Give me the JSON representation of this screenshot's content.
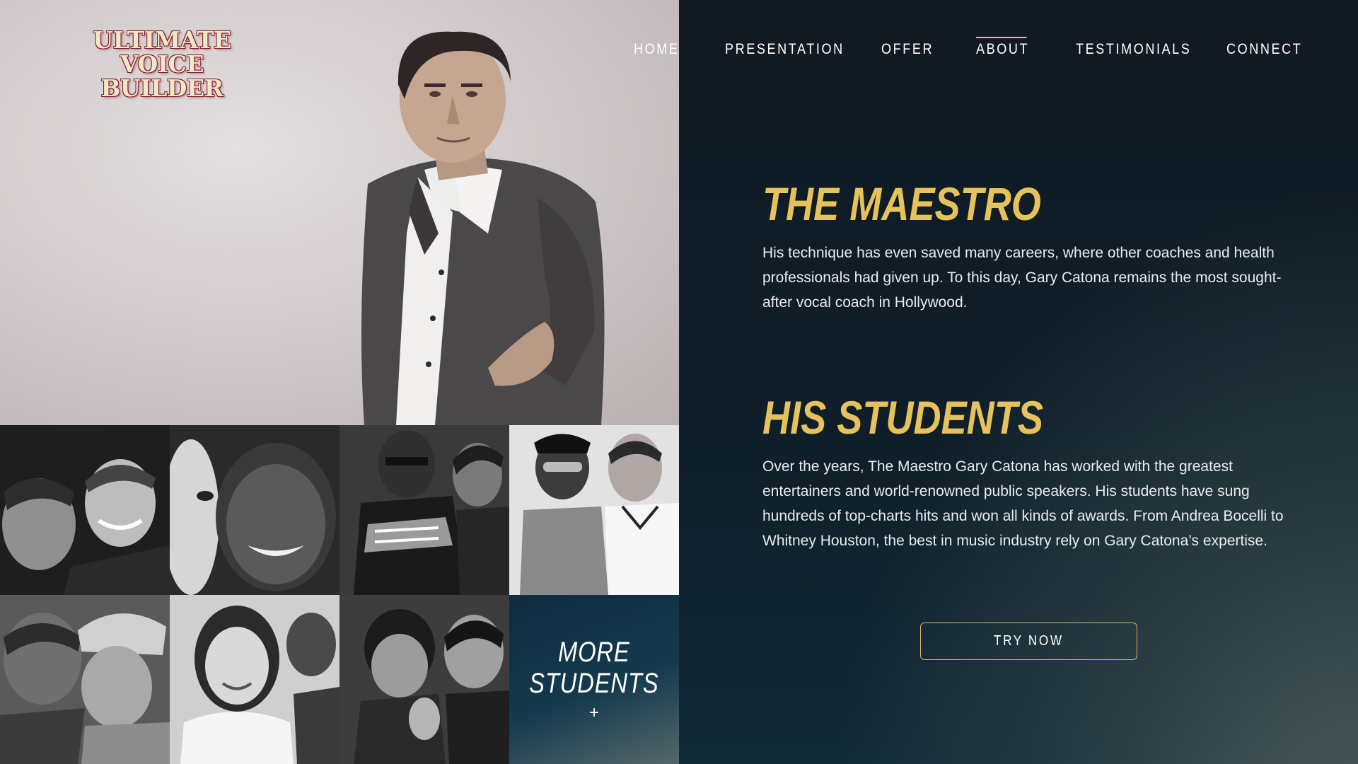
{
  "brand": {
    "logo_line1": "ULTIMATE",
    "logo_line2": "VOICE BUILDER"
  },
  "nav": {
    "items": [
      {
        "label": "HOME"
      },
      {
        "label": "PRESENTATION"
      },
      {
        "label": "OFFER"
      },
      {
        "label": "ABOUT",
        "active": true
      },
      {
        "label": "TESTIMONIALS"
      },
      {
        "label": "CONNECT"
      }
    ]
  },
  "sections": {
    "maestro": {
      "title": "THE MAESTRO",
      "body": "His technique has even saved many careers, where other coaches and health professionals had given up. To this day, Gary Catona remains the most sought-after vocal coach in Hollywood."
    },
    "students": {
      "title": "HIS STUDENTS",
      "body": "Over the years, The Maestro Gary Catona has worked with the greatest entertainers and world-renowned public speakers. His students have sung hundreds of top-charts hits and won all kinds of awards. From Andrea Bocelli to Whitney Houston, the best in music industry rely on Gary Catona’s expertise."
    }
  },
  "cta": {
    "label": "TRY NOW"
  },
  "more_students": {
    "line1": "MORE",
    "line2": "STUDENTS",
    "plus": "+"
  },
  "colors": {
    "accent_gold": "#e5c25b",
    "panel_dark": "#111a22",
    "logo_red": "#8a1e2c"
  }
}
